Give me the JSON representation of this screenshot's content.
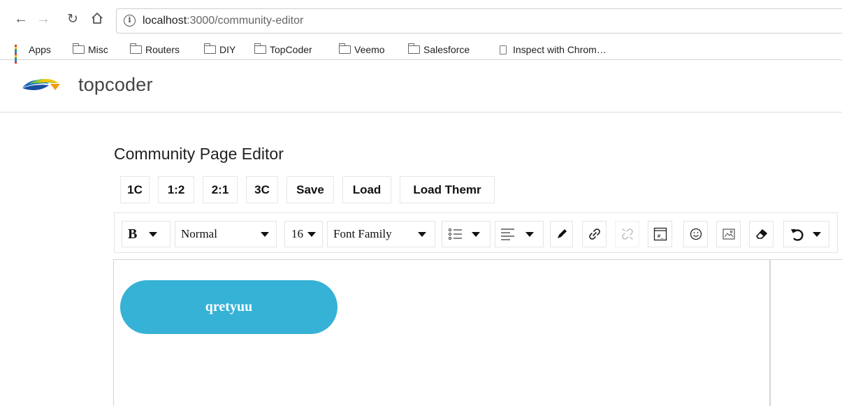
{
  "browser": {
    "url_host": "localhost",
    "url_path": ":3000/community-editor",
    "bookmarks": [
      {
        "label": "Apps",
        "icon": "apps-grid-icon"
      },
      {
        "label": "Misc",
        "icon": "folder-icon"
      },
      {
        "label": "Routers",
        "icon": "folder-icon"
      },
      {
        "label": "DIY",
        "icon": "folder-icon"
      },
      {
        "label": "TopCoder",
        "icon": "folder-icon"
      },
      {
        "label": "Veemo",
        "icon": "folder-icon"
      },
      {
        "label": "Salesforce",
        "icon": "folder-icon"
      },
      {
        "label": "Inspect with Chrom…",
        "icon": "page-icon"
      }
    ]
  },
  "site": {
    "logo_text": "topcoder"
  },
  "editor": {
    "title": "Community Page Editor",
    "layout_buttons": [
      "1C",
      "1:2",
      "2:1",
      "3C",
      "Save",
      "Load",
      "Load Themr"
    ],
    "toolbar": {
      "bold_label": "B",
      "block_type": "Normal",
      "font_size": "16",
      "font_family": "Font Family"
    },
    "canvas": {
      "button_text": "qretyuu"
    }
  },
  "colors": {
    "button_bg": "#35b2d6",
    "logo_blue": "#1f6fc4",
    "logo_green": "#6cc24a",
    "logo_yellow": "#f5c400"
  }
}
